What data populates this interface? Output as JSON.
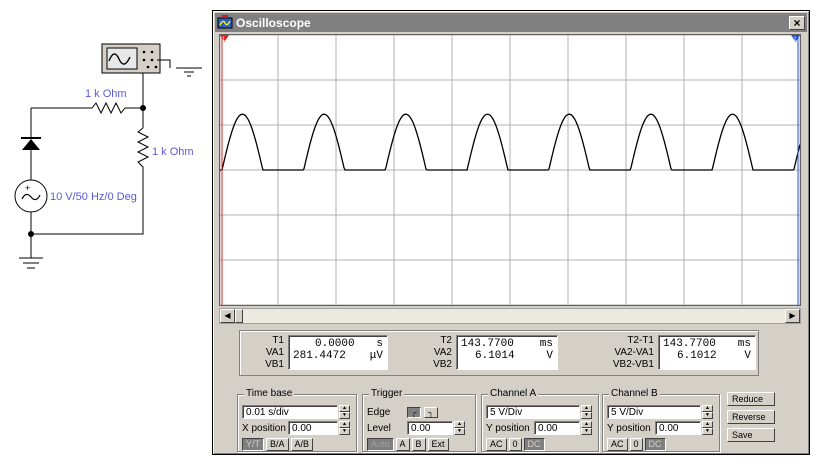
{
  "circuit": {
    "resistor1_label": "1 k Ohm",
    "resistor2_label": "1 k Ohm",
    "source_label": "10 V/50 Hz/0 Deg"
  },
  "window": {
    "title": "Oscilloscope",
    "close_label": "×"
  },
  "screen": {
    "marker_left": "1",
    "marker_right": "2"
  },
  "readout": {
    "t1": {
      "labels": [
        "T1",
        "VA1",
        "VB1"
      ],
      "time": "0.0000",
      "time_unit": "s",
      "va": "281.4472",
      "va_unit": "μV",
      "vb": "",
      "vb_unit": ""
    },
    "t2": {
      "labels": [
        "T2",
        "VA2",
        "VB2"
      ],
      "time": "143.7700",
      "time_unit": "ms",
      "va": "6.1014",
      "va_unit": "V",
      "vb": "",
      "vb_unit": ""
    },
    "dt": {
      "labels": [
        "T2-T1",
        "VA2-VA1",
        "VB2-VB1"
      ],
      "time": "143.7700",
      "time_unit": "ms",
      "va": "6.1012",
      "va_unit": "V",
      "vb": "",
      "vb_unit": ""
    }
  },
  "timebase": {
    "title": "Time base",
    "value": "0.01 s/div",
    "xpos_label": "X position",
    "xpos_value": "0.00",
    "modes": [
      "Y/T",
      "B/A",
      "A/B"
    ]
  },
  "trigger": {
    "title": "Trigger",
    "edge_label": "Edge",
    "level_label": "Level",
    "level_value": "0.00",
    "sources": [
      "Auto",
      "A",
      "B",
      "Ext"
    ]
  },
  "channel_a": {
    "title": "Channel A",
    "value": "5 V/Div",
    "ypos_label": "Y position",
    "ypos_value": "0.00",
    "couplings": [
      "AC",
      "0",
      "DC"
    ]
  },
  "channel_b": {
    "title": "Channel B",
    "value": "5 V/Div",
    "ypos_label": "Y position",
    "ypos_value": "0.00",
    "couplings": [
      "AC",
      "0",
      "DC"
    ]
  },
  "actions": {
    "reduce": "Reduce",
    "reverse": "Reverse",
    "save": "Save"
  },
  "colors": {
    "trace": "#000000",
    "grid": "#b0b0b0",
    "cursor1": "#e02020",
    "cursor2": "#2050d0",
    "window_face": "#d4d0c8",
    "label_blue": "#5a5ad6"
  }
}
